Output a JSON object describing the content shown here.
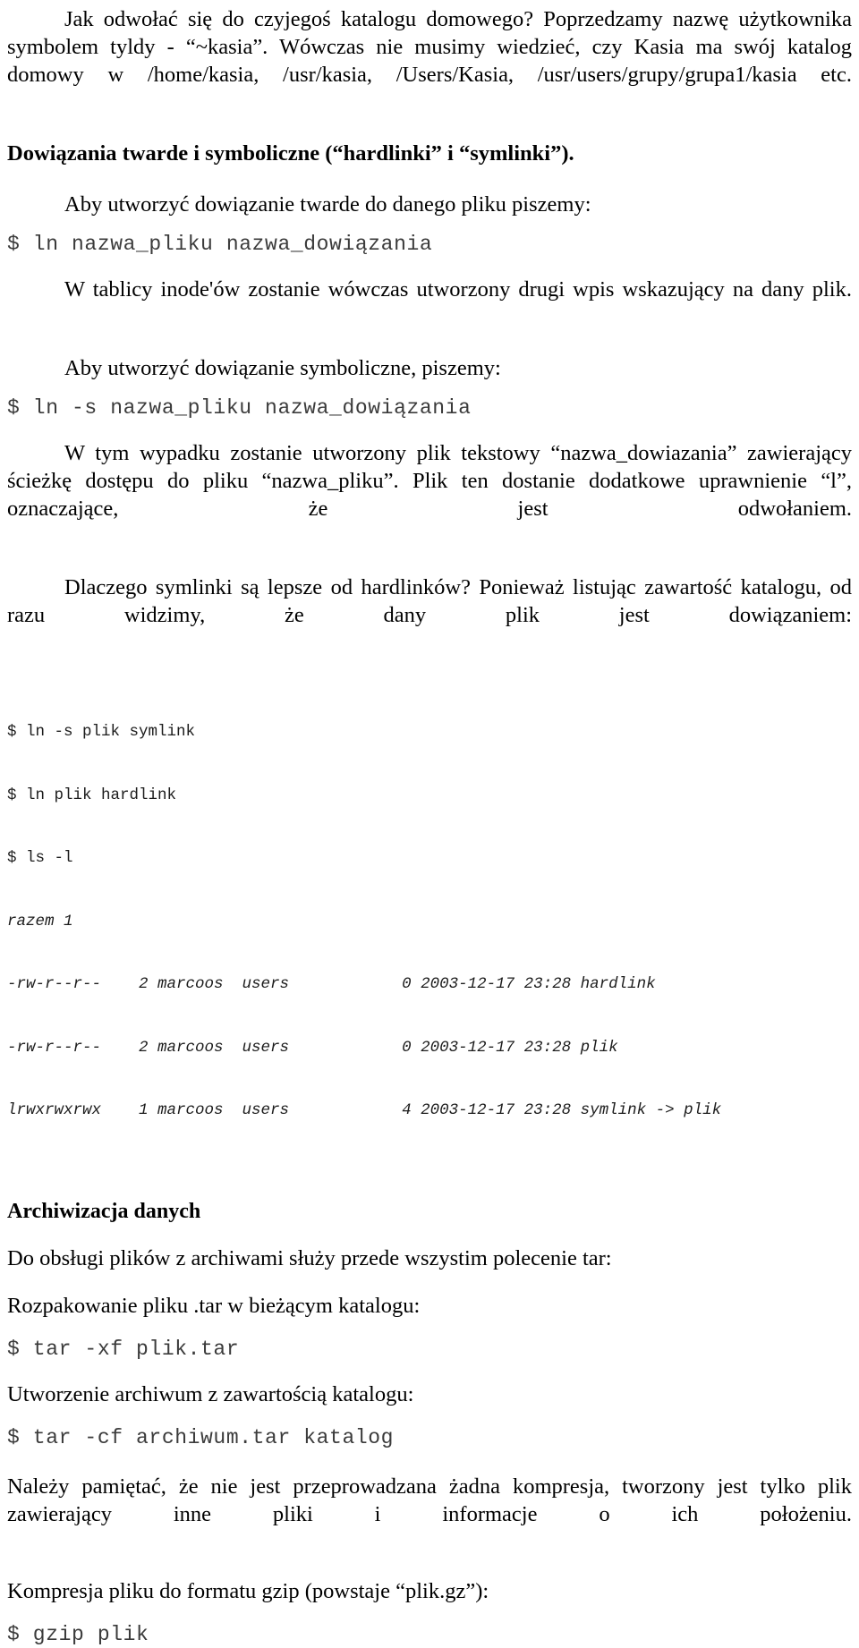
{
  "document": {
    "language": "pl",
    "text_color": "#000000",
    "code_color": "#3b3b3b",
    "background_color": "#ffffff"
  },
  "blocks": {
    "intro_paragraph": "Jak odwołać się do czyjegoś katalogu domowego? Poprzedzamy nazwę użytkownika symbolem tyldy - “~kasia”. Wówczas nie musimy wiedzieć, czy Kasia ma swój katalog domowy w /home/kasia, /usr/kasia, /Users/Kasia, /usr/users/grupy/grupa1/kasia etc.",
    "heading_links": "Dowiązania twarde i symboliczne (“hardlinki” i “symlinki”).",
    "hardlink_intro": "Aby utworzyć dowiązanie twarde do danego pliku piszemy:",
    "code_ln_hard": "$ ln nazwa_pliku nazwa_dowiązania",
    "inode_paragraph": "W tablicy inode'ów zostanie wówczas utworzony drugi wpis wskazujący na dany plik.",
    "symlink_intro": "Aby utworzyć dowiązanie symboliczne, piszemy:",
    "code_ln_sym": "$ ln -s nazwa_pliku nazwa_dowiązania",
    "symlink_explain": "W tym wypadku zostanie utworzony plik tekstowy “nazwa_dowiazania” zawierający ścieżkę dostępu do pliku “nazwa_pliku”.  Plik ten dostanie dodatkowe uprawnienie “l”, oznaczające, że jest odwołaniem.",
    "why_symlinks": "Dlaczego symlinki są lepsze od hardlinków? Ponieważ listując zawartość katalogu, od razu widzimy, że dany plik jest dowiązaniem:",
    "heading_archiving": "Archiwizacja danych",
    "tar_intro": "Do obsługi plików z archiwami służy przede wszystim polecenie tar:",
    "untar_label": "Rozpakowanie pliku .tar w bieżącym katalogu:",
    "code_tar_x": "$ tar -xf plik.tar",
    "create_archive_label": "Utworzenie archiwum z zawartością katalogu:",
    "code_tar_c": "$ tar -cf archiwum.tar katalog",
    "no_compression_note": "Należy pamiętać, że nie jest przeprowadzana żadna kompresja, tworzony jest tylko plik zawierający inne pliki i informacje o ich położeniu.",
    "gzip_label": "Kompresja pliku do formatu gzip (powstaje “plik.gz”):",
    "code_gzip": "$ gzip plik"
  },
  "terminal": {
    "commands": [
      "$ ln -s plik symlink",
      "$ ln plik hardlink",
      "$ ls -l"
    ],
    "total_line": "razem 1",
    "listing": [
      "-rw-r--r--    2 marcoos  users            0 2003-12-17 23:28 hardlink",
      "-rw-r--r--    2 marcoos  users            0 2003-12-17 23:28 plik",
      "lrwxrwxrwx    1 marcoos  users            4 2003-12-17 23:28 symlink -> plik"
    ],
    "entries": [
      {
        "permissions": "-rw-r--r--",
        "links": "2",
        "owner": "marcoos",
        "group": "users",
        "size": "0",
        "date": "2003-12-17",
        "time": "23:28",
        "name": "hardlink"
      },
      {
        "permissions": "-rw-r--r--",
        "links": "2",
        "owner": "marcoos",
        "group": "users",
        "size": "0",
        "date": "2003-12-17",
        "time": "23:28",
        "name": "plik"
      },
      {
        "permissions": "lrwxrwxrwx",
        "links": "1",
        "owner": "marcoos",
        "group": "users",
        "size": "4",
        "date": "2003-12-17",
        "time": "23:28",
        "name": "symlink -> plik"
      }
    ]
  }
}
